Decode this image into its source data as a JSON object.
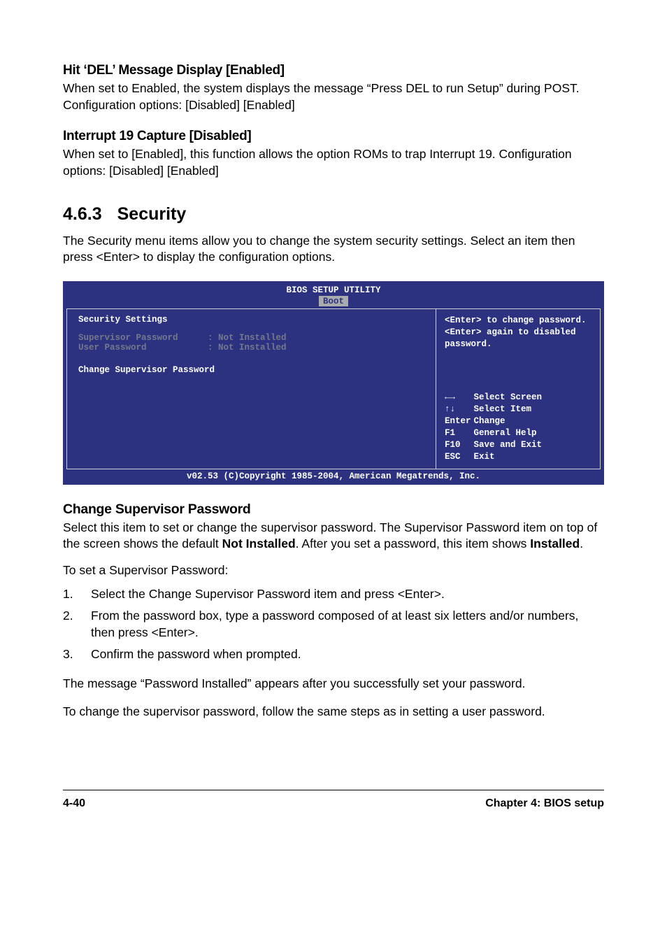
{
  "h1": {
    "title": "Hit ‘DEL’ Message Display [Enabled]",
    "body": "When set to Enabled, the system displays the message “Press DEL to run Setup” during POST. Configuration options: [Disabled] [Enabled]"
  },
  "h2": {
    "title": "Interrupt 19 Capture [Disabled]",
    "body": "When set to [Enabled], this function allows the option ROMs to trap Interrupt 19. Configuration options: [Disabled] [Enabled]"
  },
  "sec": {
    "num": "4.6.3",
    "title": "Security",
    "intro": "The Security menu items allow you to change the system security settings. Select an item then press <Enter> to display the configuration options."
  },
  "bios": {
    "header": "BIOS SETUP UTILITY",
    "tab": "Boot",
    "left": {
      "heading": "Security Settings",
      "rows": [
        {
          "label": "Supervisor Password",
          "value": ": Not Installed"
        },
        {
          "label": "User Password",
          "value": ": Not Installed"
        }
      ],
      "action": "Change Supervisor Password"
    },
    "right": {
      "hint1": "<Enter> to change password.",
      "hint2": "<Enter> again to disabled password.",
      "keys": [
        {
          "k": "←→",
          "d": "Select Screen"
        },
        {
          "k": "↑↓",
          "d": "Select Item"
        },
        {
          "k": "Enter",
          "d": "Change"
        },
        {
          "k": "F1",
          "d": "General Help"
        },
        {
          "k": "F10",
          "d": "Save and Exit"
        },
        {
          "k": "ESC",
          "d": "Exit"
        }
      ]
    },
    "footer": "v02.53 (C)Copyright 1985-2004, American Megatrends, Inc."
  },
  "change": {
    "title": "Change Supervisor Password",
    "p1a": "Select this item to set or change the supervisor password. The Supervisor Password item on top of the screen shows the default ",
    "p1b": "Not Installed",
    "p1c": ". After you set a password, this item shows ",
    "p1d": "Installed",
    "p1e": ".",
    "p2": "To set a Supervisor Password:",
    "steps": [
      "Select the Change Supervisor Password item and press <Enter>.",
      "From the password box, type a password composed of at least six letters and/or numbers, then press <Enter>.",
      "Confirm the password when prompted."
    ],
    "p3": "The message “Password Installed” appears after you successfully set your password.",
    "p4": "To change the supervisor password, follow the same steps as in setting a user password."
  },
  "footer": {
    "left": "4-40",
    "right": "Chapter 4: BIOS setup"
  }
}
